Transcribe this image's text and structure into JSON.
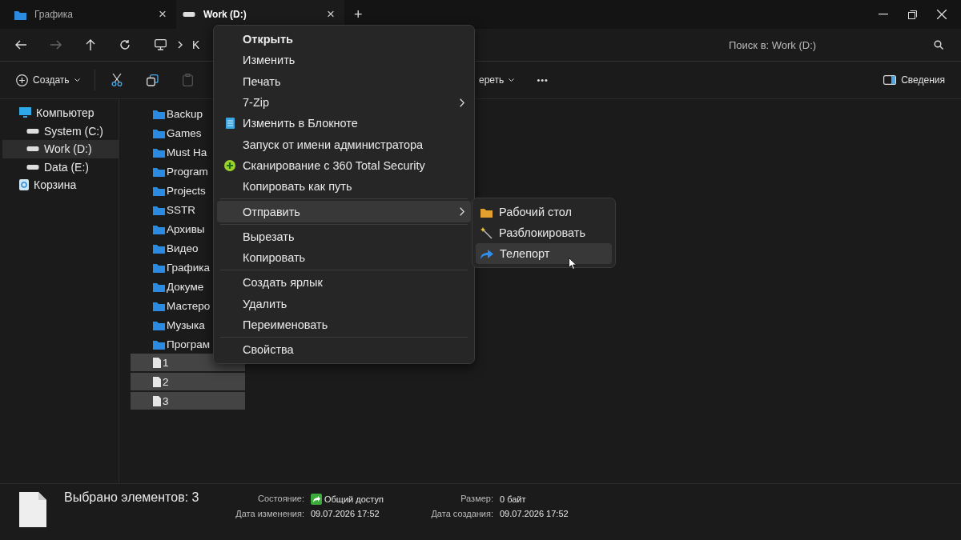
{
  "tabs": [
    {
      "label": "Графика",
      "kind": "folder",
      "selected": false,
      "close": "×"
    },
    {
      "label": "Work (D:)",
      "kind": "drive",
      "selected": true,
      "close": "×"
    }
  ],
  "new_tab": "+",
  "nav": {
    "breadcrumb": "K",
    "search": {
      "placeholder": "Поиск в: Work (D:)"
    }
  },
  "toolbar": {
    "create": "Создать",
    "view_cut": "ереть",
    "more": "•••",
    "details": "Сведения"
  },
  "sidebar": {
    "items": [
      {
        "label": "Компьютер",
        "kind": "pc",
        "selected": false,
        "children": [
          {
            "label": "System (C:)",
            "kind": "drive",
            "selected": false
          },
          {
            "label": "Work (D:)",
            "kind": "drive",
            "selected": true
          },
          {
            "label": "Data (E:)",
            "kind": "drive",
            "selected": false
          }
        ]
      },
      {
        "label": "Корзина",
        "kind": "bin",
        "selected": false
      }
    ]
  },
  "files": [
    {
      "name": "Backup",
      "kind": "folder",
      "selected": false
    },
    {
      "name": "Games",
      "kind": "folder",
      "selected": false
    },
    {
      "name": "Must Ha",
      "kind": "folder",
      "selected": false
    },
    {
      "name": "Program",
      "kind": "folder",
      "selected": false
    },
    {
      "name": "Projects",
      "kind": "folder",
      "selected": false
    },
    {
      "name": "SSTR",
      "kind": "folder",
      "selected": false
    },
    {
      "name": "Архивы",
      "kind": "folder",
      "selected": false
    },
    {
      "name": "Видео",
      "kind": "folder",
      "selected": false
    },
    {
      "name": "Графика",
      "kind": "folder",
      "selected": false
    },
    {
      "name": "Докуме",
      "kind": "folder",
      "selected": false
    },
    {
      "name": "Мастеро",
      "kind": "folder",
      "selected": false
    },
    {
      "name": "Музыка",
      "kind": "folder",
      "selected": false
    },
    {
      "name": "Програм",
      "kind": "folder",
      "selected": false
    },
    {
      "name": "1",
      "kind": "file",
      "selected": true
    },
    {
      "name": "2",
      "kind": "file",
      "selected": true
    },
    {
      "name": "3",
      "kind": "file",
      "selected": true
    }
  ],
  "context_menu": {
    "groups": [
      [
        {
          "label": "Открыть",
          "kind": "default",
          "highlighted": false
        },
        {
          "label": "Изменить",
          "kind": "plain",
          "highlighted": false
        },
        {
          "label": "Печать",
          "kind": "plain",
          "highlighted": false
        },
        {
          "label": "7-Zip",
          "kind": "submenu",
          "highlighted": false
        },
        {
          "label": "Изменить в Блокноте",
          "kind": "notepad",
          "highlighted": false
        },
        {
          "label": "Запуск от имени администратора",
          "kind": "plain",
          "highlighted": false
        },
        {
          "label": "Сканирование с 360 Total Security",
          "kind": "scanner",
          "highlighted": false
        },
        {
          "label": "Копировать как путь",
          "kind": "plain",
          "highlighted": false
        }
      ],
      [
        {
          "label": "Отправить",
          "kind": "submenu",
          "highlighted": true
        }
      ],
      [
        {
          "label": "Вырезать",
          "kind": "plain",
          "highlighted": false
        },
        {
          "label": "Копировать",
          "kind": "plain",
          "highlighted": false
        }
      ],
      [
        {
          "label": "Создать ярлык",
          "kind": "plain",
          "highlighted": false
        },
        {
          "label": "Удалить",
          "kind": "plain",
          "highlighted": false
        },
        {
          "label": "Переименовать",
          "kind": "plain",
          "highlighted": false
        }
      ],
      [
        {
          "label": "Свойства",
          "kind": "plain",
          "highlighted": false
        }
      ]
    ]
  },
  "send_to_menu": [
    {
      "label": "Рабочий стол",
      "kind": "folder",
      "highlighted": false
    },
    {
      "label": "Разблокировать",
      "kind": "wand",
      "highlighted": false
    },
    {
      "label": "Телепорт",
      "kind": "share",
      "highlighted": true
    }
  ],
  "status_bar": {
    "title": "Выбрано элементов: 3",
    "fields": [
      {
        "label": "Состояние:",
        "value": "Общий доступ",
        "kind": "shared"
      },
      {
        "label": "Размер:",
        "value": "0 байт",
        "kind": "plain"
      },
      {
        "label": "Дата изменения:",
        "value": "09.07.2026 17:52",
        "kind": "plain"
      },
      {
        "label": "Дата создания:",
        "value": "09.07.2026 17:52",
        "kind": "plain"
      }
    ]
  }
}
